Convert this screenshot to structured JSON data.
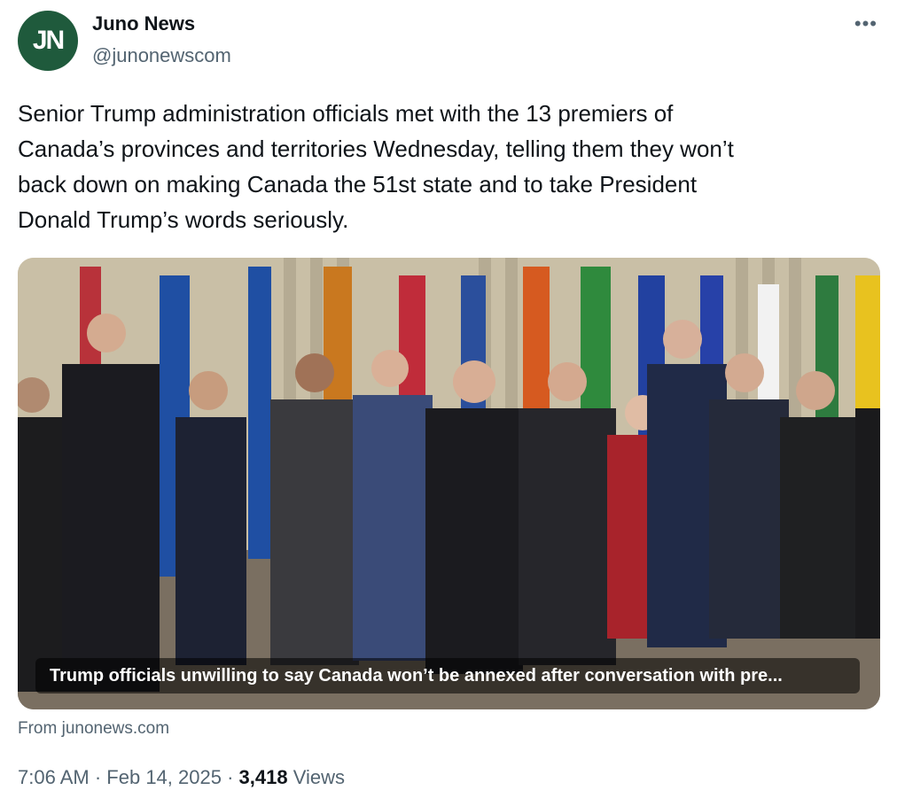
{
  "account": {
    "name": "Juno News",
    "handle": "@junonewscom",
    "avatar_text": "JN",
    "avatar_color": "#1f5a3c"
  },
  "more_icon": "more-options-icon",
  "tweet": {
    "text": "Senior Trump administration officials met with the 13 premiers of\nCanada’s provinces and territories Wednesday, telling them they won’t\nback down on making Canada the 51st state and to take President\nDonald Trump’s words seriously."
  },
  "link_card": {
    "caption": "Trump officials unwilling to say Canada won’t be annexed after conversation with pre...",
    "source": "From junonews.com"
  },
  "meta": {
    "time": "7:06 AM",
    "separator": "·",
    "date": "Feb 14, 2025",
    "views_count": "3,418",
    "views_label": "Views"
  }
}
